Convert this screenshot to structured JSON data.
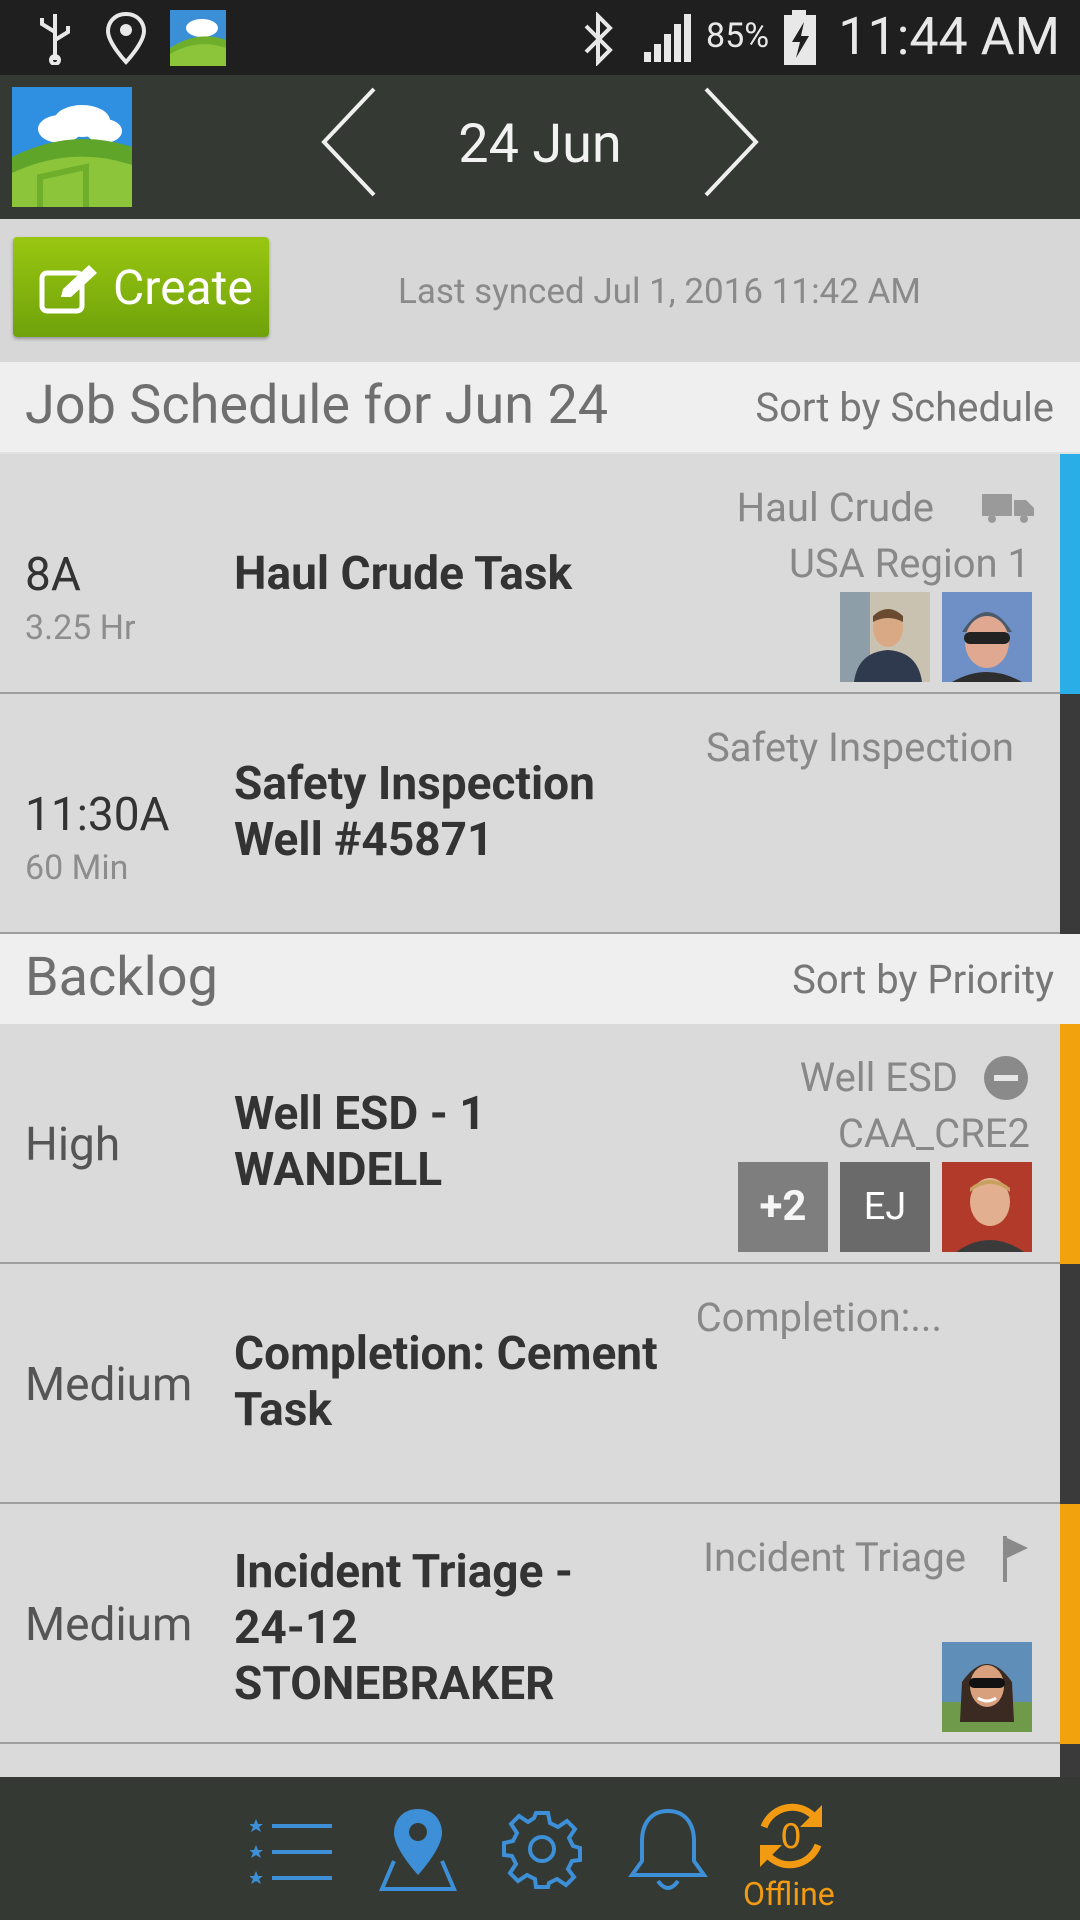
{
  "status_bar": {
    "battery": "85%",
    "time": "11:44 AM"
  },
  "header": {
    "date": "24 Jun"
  },
  "toolbar": {
    "create_label": "Create",
    "last_synced": "Last synced Jul 1, 2016 11:42 AM"
  },
  "schedule": {
    "title": "Job Schedule for Jun 24",
    "sort": "Sort by Schedule",
    "items": [
      {
        "time": "8A",
        "duration": "3.25 Hr",
        "name": "Haul Crude Task",
        "type": "Haul Crude",
        "location": "USA Region 1",
        "icon": "truck-icon",
        "stripe": "#29aee8"
      },
      {
        "time": "11:30A",
        "duration": "60 Min",
        "name_line1": "Safety Inspection",
        "name_line2": "Well #45871",
        "type": "Safety Inspection",
        "stripe": "#3a3a3a"
      }
    ]
  },
  "backlog": {
    "title": "Backlog",
    "sort": "Sort by Priority",
    "items": [
      {
        "priority": "High",
        "name_line1": "Well ESD  - 1",
        "name_line2": "WANDELL",
        "type": "Well ESD",
        "location": "CAA_CRE2",
        "extra_count": "+2",
        "initials": "EJ",
        "icon": "minus-circle-icon",
        "stripe": "#f2a20c"
      },
      {
        "priority": "Medium",
        "name_line1": "Completion: Cement",
        "name_line2": "Task",
        "type": "Completion:...",
        "stripe": "#3a3a3a"
      },
      {
        "priority": "Medium",
        "name_line1": "Incident Triage -",
        "name_line2": "24-12",
        "name_line3": "STONEBRAKER",
        "type": "Incident Triage",
        "icon": "flag-icon",
        "stripe": "#f2a20c"
      }
    ]
  },
  "bottom_nav": {
    "offline_label": "Offline",
    "offline_count": "0"
  },
  "colors": {
    "accent_green": "#7fb20f",
    "header_bg": "#343a33",
    "offline_orange": "#f29b12",
    "nav_blue": "#3d8fd8"
  }
}
